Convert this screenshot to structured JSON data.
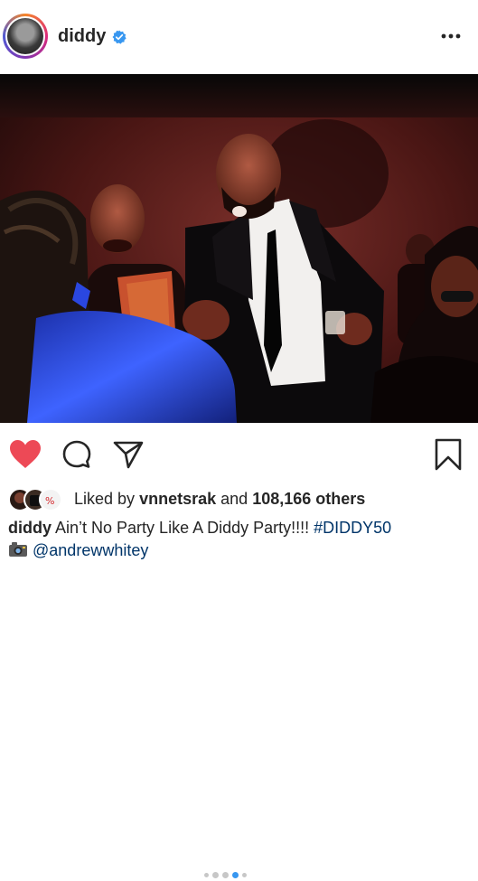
{
  "post": {
    "username": "diddy",
    "verified": true,
    "likes": {
      "prefix": "Liked by",
      "first_user": "vnnetsrak",
      "middle": "and",
      "count": "108,166 others"
    },
    "caption": {
      "username": "diddy",
      "text": "Ain’t No Party Like A Diddy Party!!!!",
      "hashtag": "#DIDDY50"
    },
    "credit": {
      "icon": "camera-emoji",
      "mention": "@andrewwhitey"
    }
  },
  "carousel": {
    "count": 5,
    "active_index": 3
  },
  "icons": {
    "like": "heart-filled-icon",
    "comment": "comment-bubble-icon",
    "share": "paper-plane-icon",
    "save": "bookmark-icon",
    "more": "more-dots-icon",
    "verified": "verified-badge-icon"
  },
  "colors": {
    "like_red": "#ed4956",
    "verified_blue": "#3897f0",
    "link_blue": "#003569",
    "active_dot": "#3897f0"
  }
}
